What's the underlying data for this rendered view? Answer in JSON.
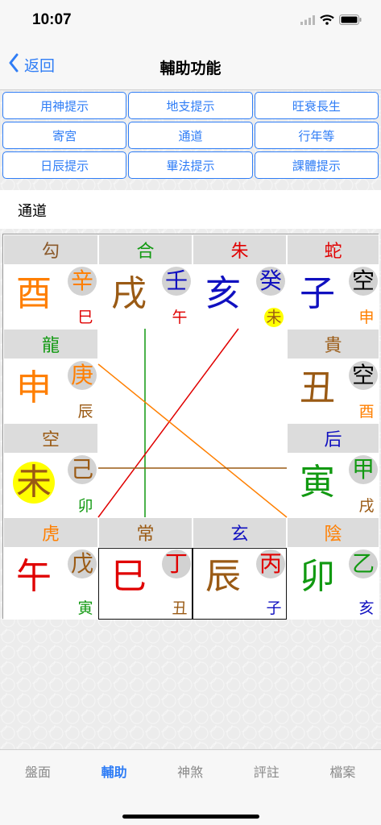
{
  "status": {
    "time": "10:07"
  },
  "nav": {
    "back_label": "返回",
    "title": "輔助功能"
  },
  "buttons": [
    "用神提示",
    "地支提示",
    "旺衰長生",
    "寄宮",
    "通道",
    "行年等",
    "日辰提示",
    "畢法提示",
    "課體提示"
  ],
  "selected_label": "通道",
  "board": {
    "cells": [
      {
        "head": "勾",
        "head_color": "#8b5a2b",
        "main": "酉",
        "main_color": "#ff7f00",
        "main_hl": false,
        "stem": "辛",
        "stem_color": "#ff7f00",
        "small": "巳",
        "small_color": "#e00000",
        "small_hl": false,
        "boxed": false
      },
      {
        "head": "合",
        "head_color": "#119911",
        "main": "戌",
        "main_color": "#9a5a14",
        "main_hl": false,
        "stem": "壬",
        "stem_color": "#1010c0",
        "small": "午",
        "small_color": "#e00000",
        "small_hl": false,
        "boxed": false
      },
      {
        "head": "朱",
        "head_color": "#e00000",
        "main": "亥",
        "main_color": "#1010c0",
        "main_hl": false,
        "stem": "癸",
        "stem_color": "#1010c0",
        "small": "未",
        "small_color": "#9a5a14",
        "small_hl": true,
        "boxed": false
      },
      {
        "head": "蛇",
        "head_color": "#e00000",
        "main": "子",
        "main_color": "#1010c0",
        "main_hl": false,
        "stem": "空",
        "stem_color": "#000000",
        "small": "申",
        "small_color": "#ff7f00",
        "small_hl": false,
        "boxed": false
      },
      {
        "head": "龍",
        "head_color": "#119911",
        "main": "申",
        "main_color": "#ff7f00",
        "main_hl": false,
        "stem": "庚",
        "stem_color": "#ff7f00",
        "small": "辰",
        "small_color": "#9a5a14",
        "small_hl": false,
        "boxed": false
      },
      {
        "head": "貴",
        "head_color": "#9a5a14",
        "main": "丑",
        "main_color": "#9a5a14",
        "main_hl": false,
        "stem": "空",
        "stem_color": "#000000",
        "small": "酉",
        "small_color": "#ff7f00",
        "small_hl": false,
        "boxed": false
      },
      {
        "head": "空",
        "head_color": "#9a5a14",
        "main": "未",
        "main_color": "#9a5a14",
        "main_hl": true,
        "stem": "己",
        "stem_color": "#9a5a14",
        "small": "卯",
        "small_color": "#119911",
        "small_hl": false,
        "boxed": false
      },
      {
        "head": "后",
        "head_color": "#1010c0",
        "main": "寅",
        "main_color": "#119911",
        "main_hl": false,
        "stem": "甲",
        "stem_color": "#119911",
        "small": "戌",
        "small_color": "#9a5a14",
        "small_hl": false,
        "boxed": false
      },
      {
        "head": "虎",
        "head_color": "#ff7f00",
        "main": "午",
        "main_color": "#e00000",
        "main_hl": false,
        "stem": "戊",
        "stem_color": "#9a5a14",
        "small": "寅",
        "small_color": "#119911",
        "small_hl": false,
        "boxed": false
      },
      {
        "head": "常",
        "head_color": "#9a5a14",
        "main": "巳",
        "main_color": "#e00000",
        "main_hl": false,
        "stem": "丁",
        "stem_color": "#e00000",
        "small": "丑",
        "small_color": "#9a5a14",
        "small_hl": false,
        "boxed": true
      },
      {
        "head": "玄",
        "head_color": "#1010c0",
        "main": "辰",
        "main_color": "#9a5a14",
        "main_hl": false,
        "stem": "丙",
        "stem_color": "#e00000",
        "small": "子",
        "small_color": "#1010c0",
        "small_hl": false,
        "boxed": true
      },
      {
        "head": "陰",
        "head_color": "#ff7f00",
        "main": "卯",
        "main_color": "#119911",
        "main_hl": false,
        "stem": "乙",
        "stem_color": "#119911",
        "small": "亥",
        "small_color": "#1010c0",
        "small_hl": false,
        "boxed": false
      }
    ],
    "channels": [
      {
        "from": "戌",
        "to": "巳",
        "color": "#119911"
      },
      {
        "from": "亥",
        "to": "巳",
        "color": "#e00000"
      },
      {
        "from": "申",
        "to": "寅",
        "color": "#ff7f00"
      },
      {
        "from": "未",
        "to": "寅",
        "color": "#9a5a14"
      }
    ]
  },
  "tabs": [
    {
      "label": "盤面",
      "active": false
    },
    {
      "label": "輔助",
      "active": true
    },
    {
      "label": "神煞",
      "active": false
    },
    {
      "label": "評註",
      "active": false
    },
    {
      "label": "檔案",
      "active": false
    }
  ]
}
